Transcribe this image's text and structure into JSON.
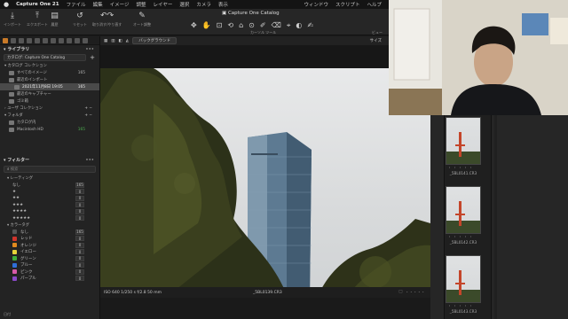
{
  "menubar": {
    "app_name": "Capture One 21",
    "items": [
      "ファイル",
      "編集",
      "イメージ",
      "調整",
      "レイヤー",
      "選択",
      "カメラ",
      "表示"
    ],
    "right_items": [
      "ウィンドウ",
      "スクリプト",
      "ヘルプ"
    ]
  },
  "window": {
    "title": "Capture One Catalog"
  },
  "toolbar": {
    "buttons": [
      {
        "label": "インポート",
        "icon": "import-icon"
      },
      {
        "label": "エクスポート",
        "icon": "export-icon"
      },
      {
        "label": "履歴",
        "icon": "history-icon"
      },
      {
        "label": "リセット",
        "icon": "reset-icon"
      },
      {
        "label": "取り消す/やり直す",
        "icon": "undo-redo-icon"
      },
      {
        "label": "オート調整",
        "icon": "auto-adjust-icon"
      }
    ],
    "cursor_tools_label": "カーソル ツール",
    "view_label": "ビュー",
    "size_label": "サイズ"
  },
  "viewer_toolbar": {
    "background_label": "バックグラウンド"
  },
  "library": {
    "title": "ライブラリ",
    "catalog_selector": "カタログ: Capture One Catalog",
    "catalog_collection": "カタログ コレクション",
    "items": [
      {
        "label": "すべてのイメージ",
        "count": "165"
      },
      {
        "label": "最近のインポート",
        "count": ""
      },
      {
        "label": "2021年11月8日 19:05",
        "count": "165",
        "selected": true
      },
      {
        "label": "最近のキャプチャー",
        "count": ""
      },
      {
        "label": "ゴミ箱",
        "count": ""
      }
    ],
    "user_collection": "ユーザ コレクション",
    "folders": "フォルダ",
    "folder_items": [
      {
        "label": "カタログ内",
        "count": ""
      },
      {
        "label": "Macintosh HD",
        "count": "165"
      }
    ]
  },
  "filters": {
    "title": "フィルター",
    "search_placeholder": "検索",
    "rating_label": "レーティング",
    "ratings": [
      {
        "label": "なし",
        "count": "165"
      },
      {
        "label": "★",
        "count": "0"
      },
      {
        "label": "★★",
        "count": "0"
      },
      {
        "label": "★★★",
        "count": "0"
      },
      {
        "label": "★★★★",
        "count": "0"
      },
      {
        "label": "★★★★★",
        "count": "0"
      }
    ],
    "color_label": "カラータグ",
    "colors": [
      {
        "label": "なし",
        "count": "165",
        "color": "#555555"
      },
      {
        "label": "レッド",
        "count": "0",
        "color": "#d0342c"
      },
      {
        "label": "オレンジ",
        "count": "0",
        "color": "#e08a1e"
      },
      {
        "label": "イエロー",
        "count": "0",
        "color": "#e6d23a"
      },
      {
        "label": "グリーン",
        "count": "0",
        "color": "#3fae3a"
      },
      {
        "label": "ブルー",
        "count": "0",
        "color": "#2f6fd8"
      },
      {
        "label": "ピンク",
        "count": "0",
        "color": "#d65aa8"
      },
      {
        "label": "パープル",
        "count": "0",
        "color": "#8a49c9"
      }
    ],
    "bottom_label": "日付"
  },
  "infobar": {
    "exif": "ISO 640    1/250 s    f/2.8    50 mm",
    "filename": "_5BL0139.CR3"
  },
  "filmstrip": {
    "items": [
      {
        "filename": "_5BL0141.CR3"
      },
      {
        "filename": "_5BL0142.CR3"
      },
      {
        "filename": "_5BL0143.CR3"
      }
    ],
    "stars": "・・・・・"
  },
  "colors": {
    "accent": "#c97a28",
    "panel": "#232323",
    "background": "#1b1b1b"
  }
}
